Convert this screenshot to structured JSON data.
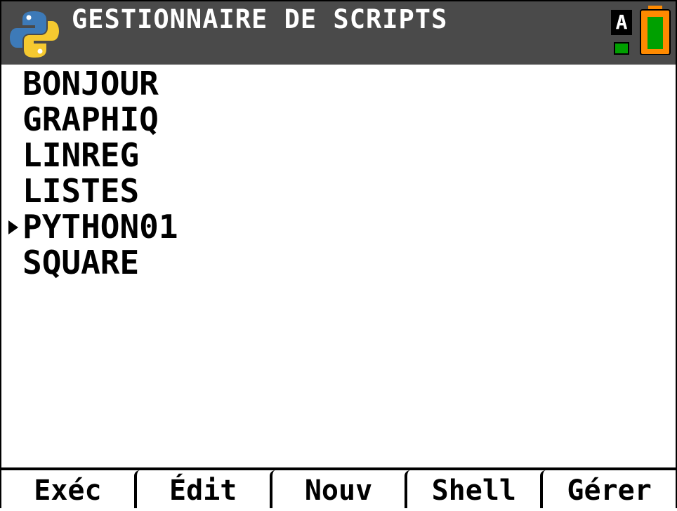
{
  "header": {
    "title": "GESTIONNAIRE DE SCRIPTS",
    "alpha_indicator": "A",
    "logo_icon": "python-logo-icon",
    "battery_icon": "battery-icon",
    "colors": {
      "bar": "#4a4a4a",
      "battery": "#ff8a00",
      "battery_fill": "#00a000"
    }
  },
  "scripts": [
    {
      "name": "BONJOUR",
      "selected": false
    },
    {
      "name": "GRAPHIQ",
      "selected": false
    },
    {
      "name": "LINREG",
      "selected": false
    },
    {
      "name": "LISTES",
      "selected": false
    },
    {
      "name": "PYTHON01",
      "selected": true
    },
    {
      "name": "SQUARE",
      "selected": false
    }
  ],
  "softkeys": [
    "Exéc",
    "Édit",
    "Nouv",
    "Shell",
    "Gérer"
  ]
}
